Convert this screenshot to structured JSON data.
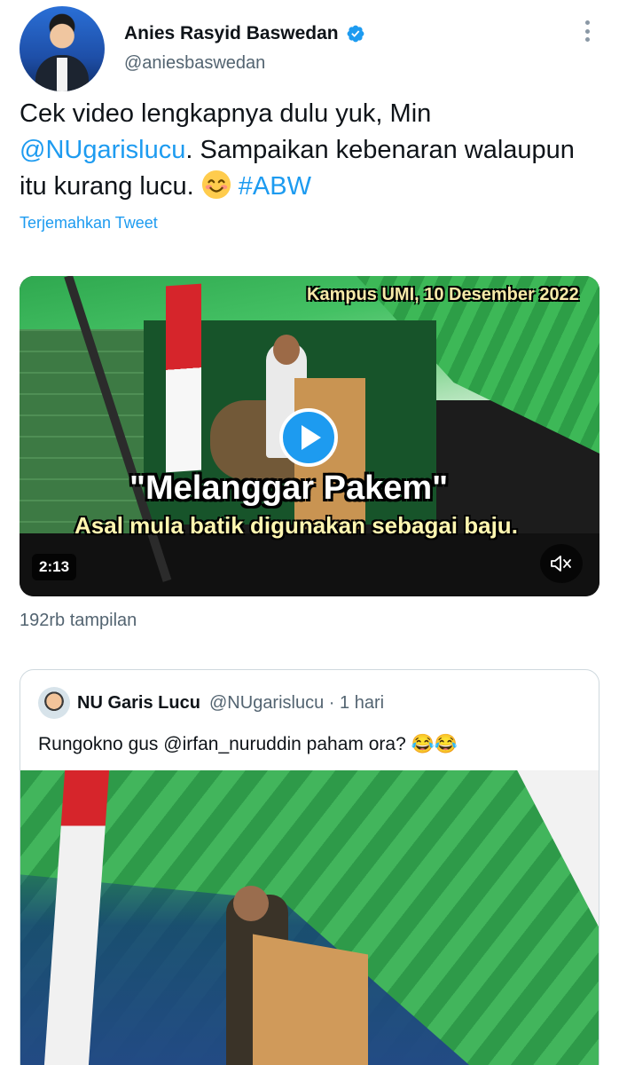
{
  "tweet": {
    "author_name": "Anies Rasyid Baswedan",
    "author_handle": "@aniesbaswedan",
    "text_part1": "Cek video lengkapnya dulu yuk, Min ",
    "mention": "@NUgarislucu",
    "text_part2": ". Sampaikan kebenaran walaupun itu kurang lucu. ",
    "hashtag": "#ABW",
    "translate_label": "Terjemahkan Tweet",
    "views": "192rb tampilan"
  },
  "video": {
    "caption_top": "Kampus UMI, 10 Desember 2022",
    "caption_main": "\"Melanggar Pakem\"",
    "caption_sub": "Asal mula batik digunakan sebagai baju.",
    "duration": "2:13"
  },
  "quote": {
    "author_name": "NU Garis Lucu",
    "author_handle": "@NUgarislucu",
    "time": "· 1 hari",
    "text": "Rungokno gus @irfan_nuruddin paham ora? 😂😂"
  },
  "colors": {
    "link": "#1d9bf0",
    "secondary_text": "#536471",
    "primary_text": "#0f1419",
    "border": "#cfd9de"
  },
  "icons": [
    "verified-badge-icon",
    "more-icon",
    "smiling-face-emoji",
    "play-icon",
    "mute-icon"
  ]
}
